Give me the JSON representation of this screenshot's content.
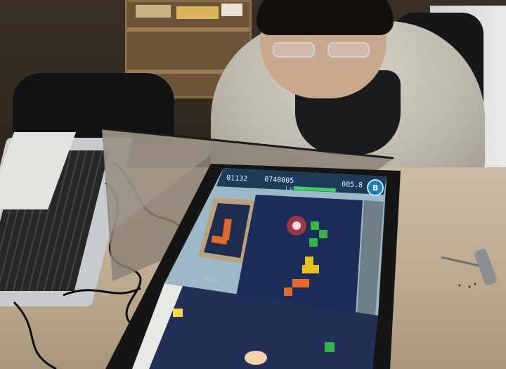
{
  "scene": {
    "description_tags": [
      "person",
      "tabletop-display",
      "keyboard",
      "mirror",
      "screwdriver"
    ]
  },
  "hud": {
    "left_readout": "01132",
    "mid_readout": "0740005",
    "right_readout": "005.8",
    "level_label": "Lv",
    "corner_badge": "B"
  },
  "playfield": {
    "bottom_counter": "0102"
  },
  "colors": {
    "screen_glow": "#c7ecff",
    "tetromino_orange": "#e06a2a",
    "tetromino_green": "#38b24a",
    "tetromino_yellow": "#e8c21e",
    "firework_red": "#d23b3b"
  }
}
